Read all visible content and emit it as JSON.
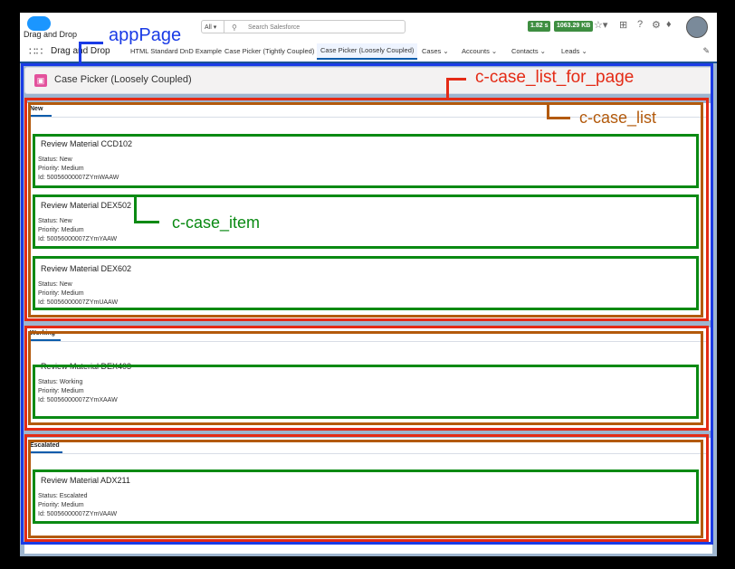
{
  "header": {
    "app_name_small": "Drag and Drop",
    "search_scope": "All ▾",
    "search_placeholder": "Search Salesforce",
    "perf_time": "1.82 s",
    "perf_size": "1063.29 KB"
  },
  "nav": {
    "app_name": "Drag and Drop",
    "items": [
      {
        "label": "HTML Standard DnD Example"
      },
      {
        "label": "Case Picker (Tightly Coupled)"
      },
      {
        "label": "Case Picker (Loosely Coupled)"
      },
      {
        "label": "Cases ⌄"
      },
      {
        "label": "Accounts ⌄"
      },
      {
        "label": "Contacts ⌄"
      },
      {
        "label": "Leads ⌄"
      }
    ]
  },
  "page_header": {
    "title": "Case Picker (Loosely Coupled)"
  },
  "lists": [
    {
      "tab": "New",
      "items": [
        {
          "title": "Review Material CCD102",
          "status": "Status: New",
          "priority": "Priority: Medium",
          "id": "Id: 50056000007ZYmWAAW"
        },
        {
          "title": "Review Material DEX502",
          "status": "Status: New",
          "priority": "Priority: Medium",
          "id": "Id: 50056000007ZYmYAAW"
        },
        {
          "title": "Review Material DEX602",
          "status": "Status: New",
          "priority": "Priority: Medium",
          "id": "Id: 50056000007ZYmUAAW"
        }
      ]
    },
    {
      "tab": "Working",
      "items": [
        {
          "title": "Review Material DEX403",
          "status": "Status: Working",
          "priority": "Priority: Medium",
          "id": "Id: 50056000007ZYmXAAW"
        }
      ]
    },
    {
      "tab": "Escalated",
      "items": [
        {
          "title": "Review Material ADX211",
          "status": "Status: Escalated",
          "priority": "Priority: Medium",
          "id": "Id: 50056000007ZYmVAAW"
        }
      ]
    }
  ],
  "annotations": {
    "app_page": "appPage",
    "case_list_for_page": "c-case_list_for_page",
    "case_list": "c-case_list",
    "case_item": "c-case_item"
  },
  "colors": {
    "app_page_outline": "#1a3be6",
    "list_for_page_outline": "#e42b16",
    "case_list_outline": "#b35a0c",
    "case_item_outline": "#0a8a13"
  }
}
